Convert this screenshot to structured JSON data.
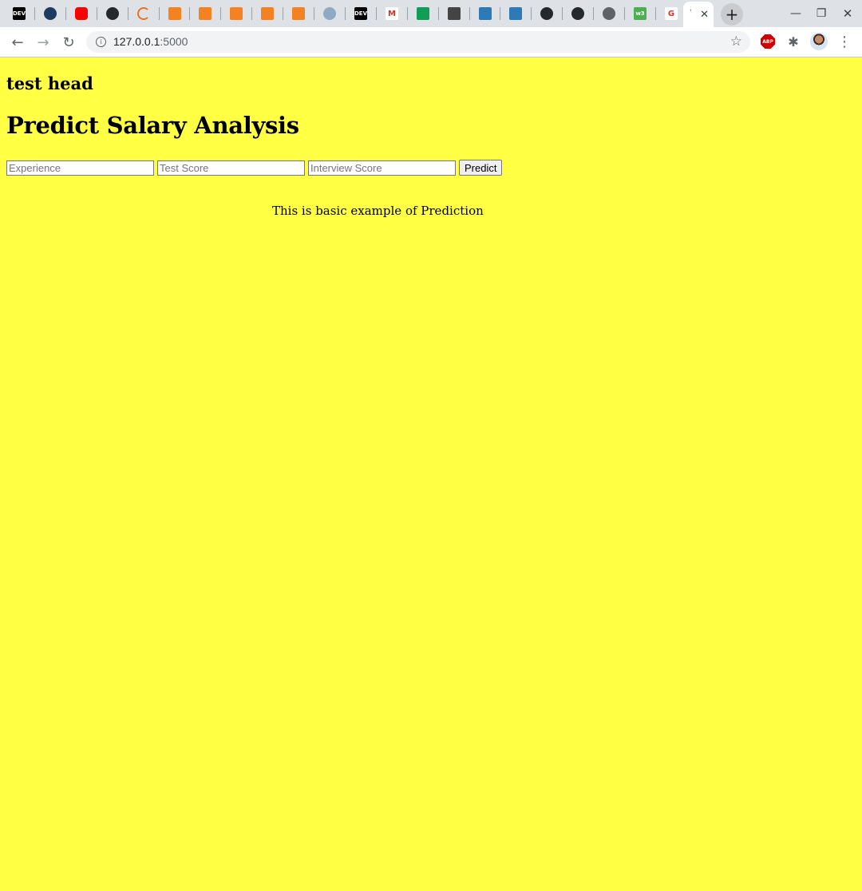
{
  "browser": {
    "tabs": [
      {
        "icon": "dev-icon",
        "text": "DEV",
        "bg": "#000000"
      },
      {
        "icon": "python-icon",
        "text": "",
        "bg": "#1e3a5f"
      },
      {
        "icon": "youtube-icon",
        "text": "",
        "bg": "#ff0000"
      },
      {
        "icon": "github-icon",
        "text": "",
        "bg": "#24292e"
      },
      {
        "icon": "spinner-icon",
        "text": "",
        "bg": "#e8731e"
      },
      {
        "icon": "book-icon",
        "text": "",
        "bg": "#f58220"
      },
      {
        "icon": "book-icon",
        "text": "",
        "bg": "#f58220"
      },
      {
        "icon": "book-icon",
        "text": "",
        "bg": "#f58220"
      },
      {
        "icon": "book-icon",
        "text": "",
        "bg": "#f58220"
      },
      {
        "icon": "book-icon",
        "text": "",
        "bg": "#f58220"
      },
      {
        "icon": "cloud-icon",
        "text": "",
        "bg": "#8fa9c2"
      },
      {
        "icon": "dev-icon",
        "text": "DEV",
        "bg": "#000000"
      },
      {
        "icon": "gmail-icon",
        "text": "M",
        "bg": "#ffffff"
      },
      {
        "icon": "sheets-icon",
        "text": "",
        "bg": "#0f9d58"
      },
      {
        "icon": "diamond-icon",
        "text": "",
        "bg": "#444444"
      },
      {
        "icon": "vscode-icon",
        "text": "",
        "bg": "#2c7bb6"
      },
      {
        "icon": "vscode-icon",
        "text": "",
        "bg": "#2c7bb6"
      },
      {
        "icon": "github-icon",
        "text": "",
        "bg": "#24292e"
      },
      {
        "icon": "github-icon",
        "text": "",
        "bg": "#24292e"
      },
      {
        "icon": "globe-icon",
        "text": "",
        "bg": "#5f6368"
      },
      {
        "icon": "w3-icon",
        "text": "w3",
        "bg": "#4caf50"
      },
      {
        "icon": "google-icon",
        "text": "G",
        "bg": "#ffffff"
      }
    ],
    "active_tab": {
      "title_stub": "'",
      "close": "✕"
    },
    "new_tab": "+",
    "window": {
      "minimize": "—",
      "restore": "❐",
      "close": "✕"
    },
    "nav": {
      "back": "←",
      "forward": "→",
      "reload": "↻"
    },
    "address": {
      "host": "127.0.0.1",
      "port": ":5000",
      "info": "i",
      "star": "☆"
    },
    "extensions": {
      "abp": "ABP",
      "puzzle": "✱",
      "menu": "⋮"
    }
  },
  "page": {
    "background": "#ffff44",
    "subheading": "test head",
    "heading": "Predict Salary Analysis",
    "form": {
      "experience_placeholder": "Experience",
      "test_score_placeholder": "Test Score",
      "interview_score_placeholder": "Interview Score",
      "submit_label": "Predict"
    },
    "note": "This is basic example of Prediction"
  }
}
